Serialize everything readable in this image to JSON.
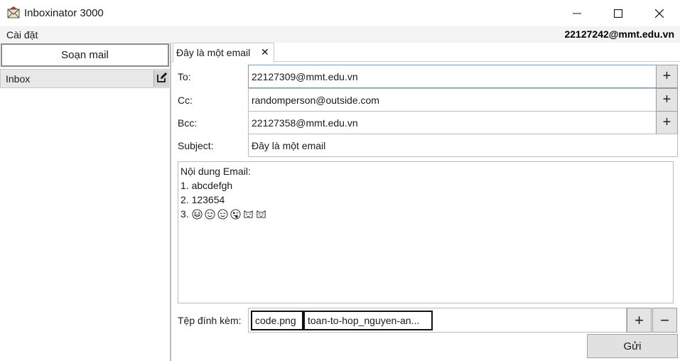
{
  "window": {
    "title": "Inboxinator 3000",
    "icons": {
      "app": "envelope-icon",
      "minimize": "minimize-icon",
      "maximize": "maximize-icon",
      "close": "close-icon"
    }
  },
  "menubar": {
    "settings_label": "Cài đặt",
    "user_email": "22127242@mmt.edu.vn"
  },
  "sidebar": {
    "compose_label": "Soạn mail",
    "folders": [
      {
        "label": "Inbox",
        "icon": "edit-icon"
      }
    ]
  },
  "tabs": [
    {
      "label": "Đây là một email",
      "close_glyph": "✕"
    }
  ],
  "compose": {
    "to_label": "To:",
    "to_value": "22127309@mmt.edu.vn",
    "cc_label": "Cc:",
    "cc_value": "randomperson@outside.com",
    "bcc_label": "Bcc:",
    "bcc_value": "22127358@mmt.edu.vn",
    "subject_label": "Subject:",
    "subject_value": "Đây là một email",
    "add_glyph": "+",
    "body": {
      "lines": [
        "Nội dung Email:",
        "1. abcdefgh",
        "2. 123654"
      ],
      "emoji_line_number": "3.",
      "emojis": [
        "grinning-squint-face",
        "smiling-face",
        "relieved-face",
        "winking-tongue-face",
        "cat-face",
        "smiling-cat-face"
      ]
    },
    "attachments_label": "Tệp đính kèm:",
    "attachments": [
      "code.png",
      "toan-to-hop_nguyen-an..."
    ],
    "attach_add_glyph": "+",
    "attach_remove_glyph": "−",
    "send_label": "Gửi"
  },
  "colors": {
    "menubar_bg": "#f3f3f3",
    "folder_selected_bg": "#e8e8e8",
    "button_bg": "#e1e1e1",
    "focus_border": "#6d9bd6"
  }
}
